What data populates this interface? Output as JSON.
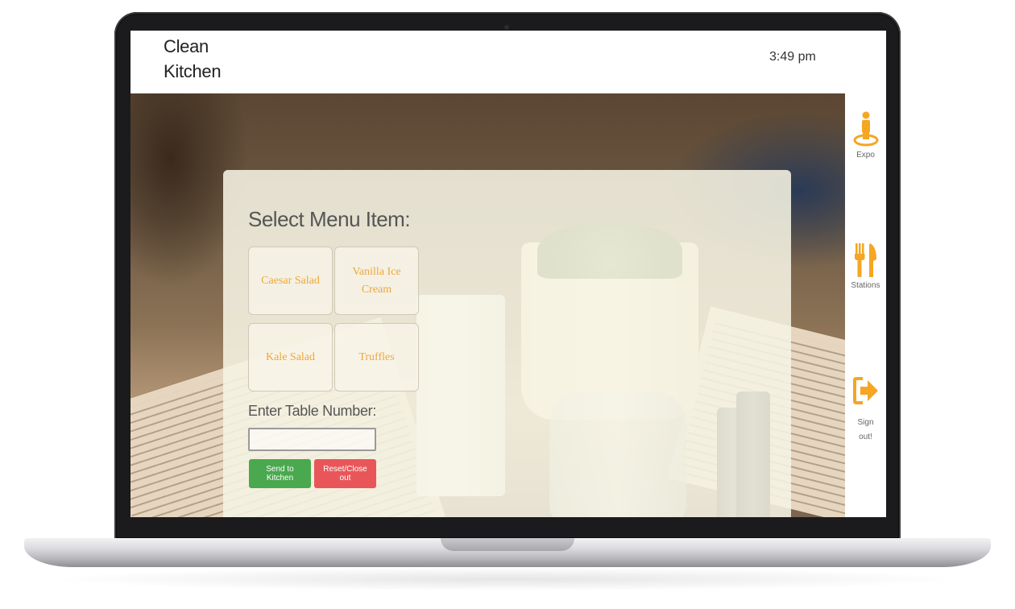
{
  "app": {
    "brand_line1": "Clean",
    "brand_line2": "Kitchen",
    "time": "3:49 pm"
  },
  "form": {
    "title": "Select Menu Item:",
    "items": [
      {
        "label": "Caesar Salad"
      },
      {
        "label": "Vanilla Ice Cream"
      },
      {
        "label": "Kale Salad"
      },
      {
        "label": "Truffles"
      }
    ],
    "table_label": "Enter Table Number:",
    "table_value": "",
    "send_button": "Send to Kitchen",
    "reset_button": "Reset/Close out"
  },
  "sidebar": {
    "items": [
      {
        "label": "Expo",
        "icon": "person-icon"
      },
      {
        "label": "Stations",
        "icon": "fork-knife-icon"
      },
      {
        "label_line1": "Sign",
        "label_line2": "out!",
        "icon": "sign-out-icon"
      }
    ]
  },
  "colors": {
    "accent": "#f0a63a",
    "send": "#4aa84f",
    "reset": "#e8565a",
    "icon": "#f5a623"
  }
}
